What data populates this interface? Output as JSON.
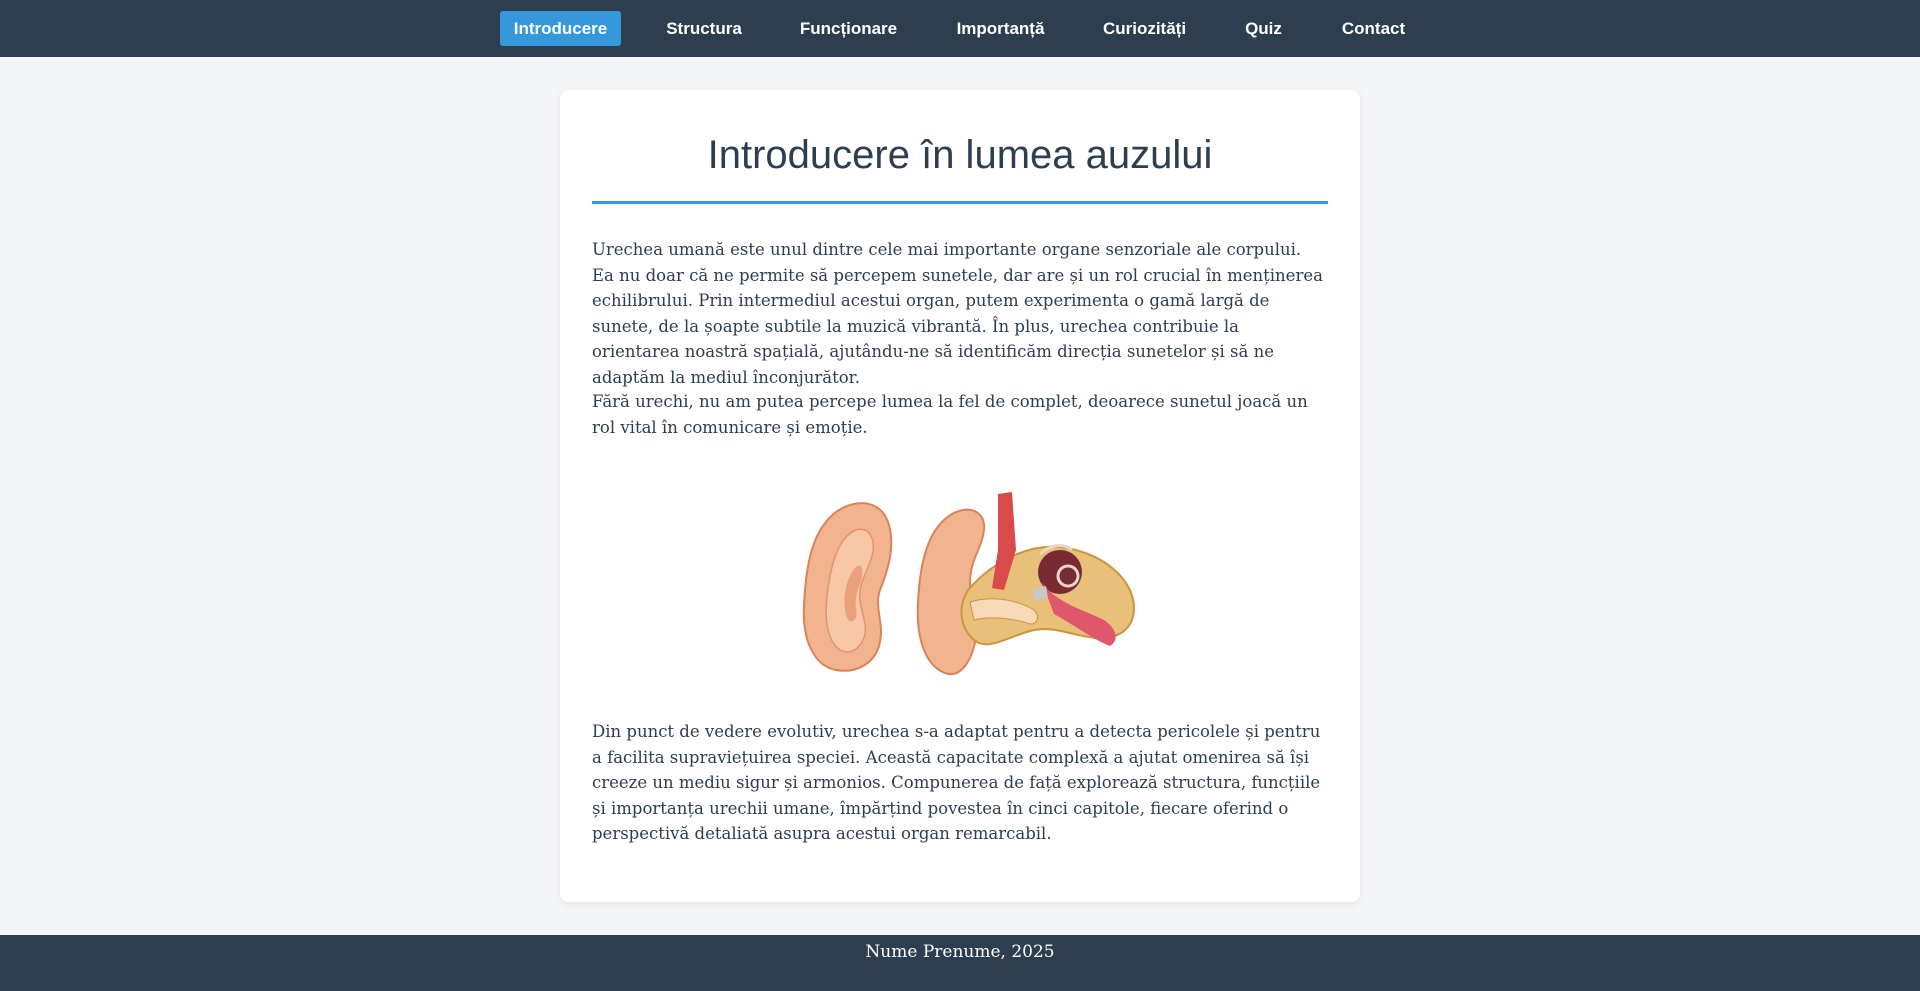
{
  "nav": {
    "items": [
      {
        "label": "Introducere",
        "active": true
      },
      {
        "label": "Structura",
        "active": false
      },
      {
        "label": "Funcționare",
        "active": false
      },
      {
        "label": "Importanță",
        "active": false
      },
      {
        "label": "Curiozități",
        "active": false
      },
      {
        "label": "Quiz",
        "active": false
      },
      {
        "label": "Contact",
        "active": false
      }
    ]
  },
  "main": {
    "title": "Introducere în lumea auzului",
    "paragraphs": [
      "Urechea umană este unul dintre cele mai importante organe senzoriale ale corpului. Ea nu doar că ne permite să percepem sunetele, dar are și un rol crucial în menținerea echilibrului. Prin intermediul acestui organ, putem experimenta o gamă largă de sunete, de la șoapte subtile la muzică vibrantă. În plus, urechea contribuie la orientarea noastră spațială, ajutându-ne să identificăm direcția sunetelor și să ne adaptăm la mediul înconjurător.",
      "Fără urechi, nu am putea percepe lumea la fel de complet, deoarece sunetul joacă un rol vital în comunicare și emoție.",
      "Din punct de vedere evolutiv, urechea s-a adaptat pentru a detecta pericolele și pentru a facilita supraviețuirea speciei. Această capacitate complexă a ajutat omenirea să își creeze un mediu sigur și armonios. Compunerea de față explorează structura, funcțiile și importanța urechii umane, împărțind povestea în cinci capitole, fiecare oferind o perspectivă detaliată asupra acestui organ remarcabil."
    ]
  },
  "colors": {
    "navbar": "#2c3e50",
    "accent": "#3498db",
    "background": "#f4f5f7",
    "card": "#ffffff",
    "text": "#2c3e50"
  },
  "footer": {
    "text": "Nume Prenume, 2025"
  }
}
